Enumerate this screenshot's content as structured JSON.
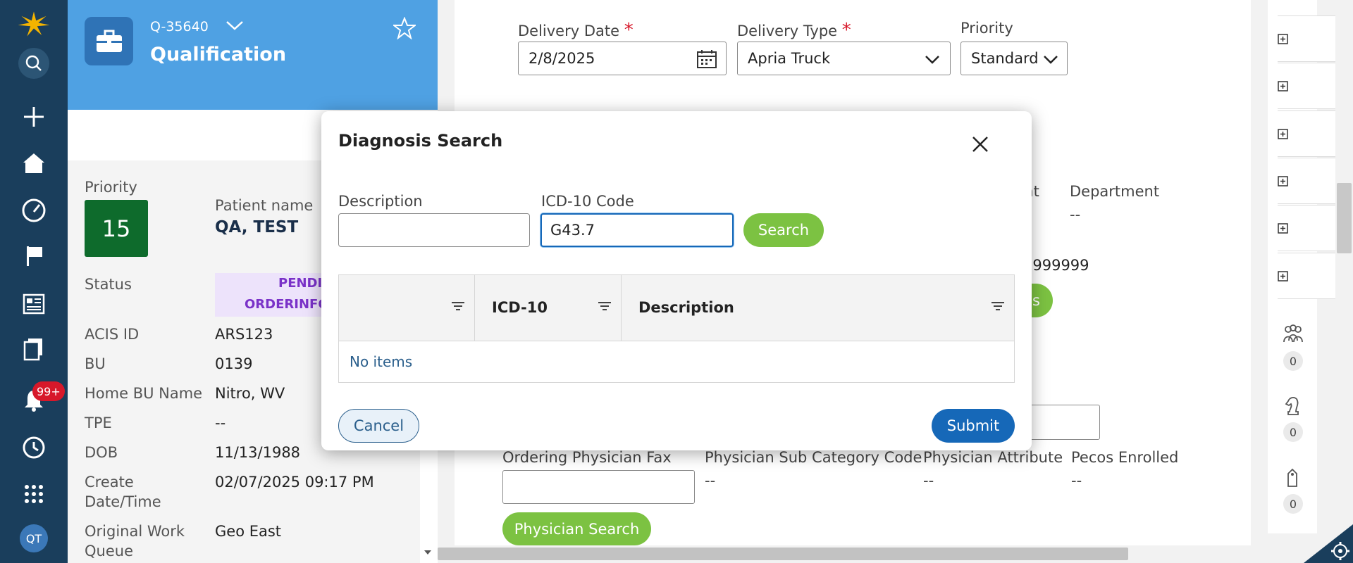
{
  "nav": {
    "icons": [
      "logo-icon",
      "search-icon",
      "plus-icon",
      "home-icon",
      "dashboard-icon",
      "flag-icon",
      "newspaper-icon",
      "documents-icon",
      "bell-icon",
      "history-icon",
      "apps-grid-icon"
    ],
    "notification_count": "99+",
    "avatar_initials": "QT",
    "brand_color": "#f4b400"
  },
  "case": {
    "id": "Q-35640",
    "title": "Qualification",
    "priority_label": "Priority",
    "priority_value": "15",
    "patient_name_label": "Patient name",
    "patient_name": "QA, TEST",
    "status_label": "Status",
    "status_line1": "PENDING-",
    "status_line2": "ORDERINFO",
    "acis_label": "ACIS ID",
    "acis_value": "ARS123",
    "bu_label": "BU",
    "bu_value": "0139",
    "home_bu_label": "Home BU Name",
    "home_bu_value": "Nitro, WV",
    "tpe_label": "TPE",
    "tpe_value": "--",
    "dob_label": "DOB",
    "dob_value": "11/13/1988",
    "create_label_1": "Create",
    "create_label_2": "Date/Time",
    "create_value": "02/07/2025 09:17 PM",
    "owq_label_1": "Original Work",
    "owq_label_2": "Queue",
    "owq_value": "Geo East"
  },
  "form": {
    "delivery_date_label": "Delivery Date",
    "delivery_date_value": "2/8/2025",
    "delivery_type_label": "Delivery Type",
    "delivery_type_value": "Apria Truck",
    "priority_label": "Priority",
    "priority_value": "Standard",
    "required_mark": "*",
    "unt_fragment": "unt",
    "department_label": "Department",
    "department_value": "--",
    "phone_fragment": "9999999",
    "btn_fragment": "s",
    "ordering_fax_label": "Ordering Physician Fax",
    "physician_sub_label": "Physician Sub Category Code",
    "physician_sub_value": "--",
    "physician_attr_label": "Physician Attribute",
    "physician_attr_value": "--",
    "pecos_label": "Pecos Enrolled",
    "pecos_value": "--",
    "physician_search_label": "Physician Search"
  },
  "rail": {
    "expanders": 6,
    "counters": [
      {
        "icon": "team-icon",
        "count": "0"
      },
      {
        "icon": "chess-knight-icon",
        "count": "0"
      },
      {
        "icon": "tag-icon",
        "count": "0"
      }
    ]
  },
  "modal": {
    "title": "Diagnosis Search",
    "description_label": "Description",
    "description_value": "",
    "icd_label": "ICD-10 Code",
    "icd_value": "G43.7",
    "search_label": "Search",
    "columns": [
      "",
      "ICD-10",
      "Description"
    ],
    "empty_text": "No items",
    "cancel_label": "Cancel",
    "submit_label": "Submit"
  }
}
